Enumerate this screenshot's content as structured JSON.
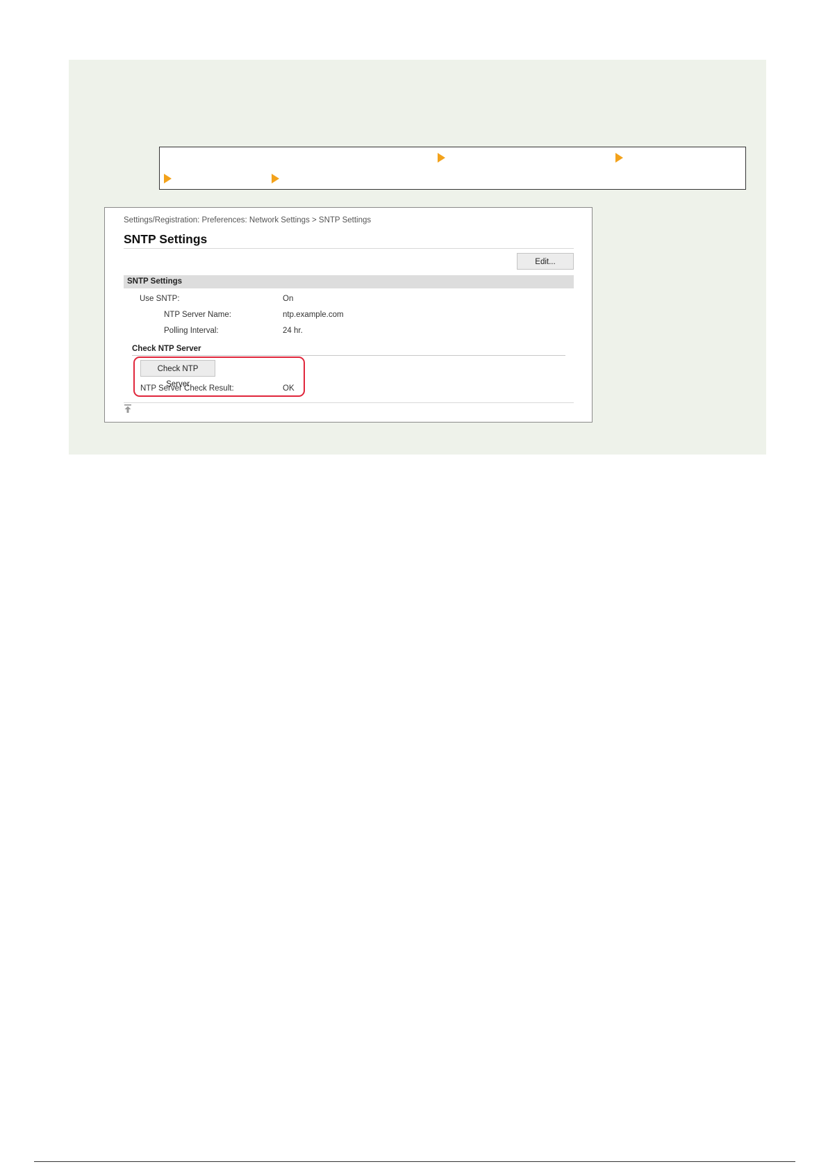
{
  "page": {
    "colors": {
      "panel_background": "#eef2ea",
      "nav_arrow": "#f3a21b",
      "highlight_frame": "#e0263b"
    }
  },
  "nav_path": {
    "arrow_icon": "triangle-right-icon"
  },
  "screenshot": {
    "breadcrumb": "Settings/Registration: Preferences: Network Settings > SNTP Settings",
    "title": "SNTP Settings",
    "edit_button_label": "Edit...",
    "section_title": "SNTP Settings",
    "rows": [
      {
        "label": "Use SNTP:",
        "value": "On"
      },
      {
        "label": "NTP Server Name:",
        "value": "ntp.example.com"
      },
      {
        "label": "Polling Interval:",
        "value": "24 hr."
      }
    ],
    "check_section": {
      "heading": "Check NTP Server",
      "button_label": "Check NTP Server",
      "result_label": "NTP Server Check Result:",
      "result_value": "OK"
    },
    "top_icon": "back-to-top-icon"
  }
}
